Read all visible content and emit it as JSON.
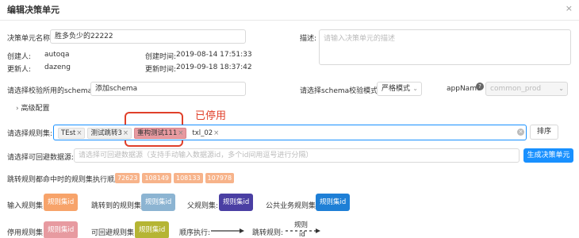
{
  "dialog": {
    "title": "编辑决策单元",
    "close_icon": "×"
  },
  "unit_name": {
    "label": "决策单元名称:",
    "value": "胜多负少的22222"
  },
  "description": {
    "label": "描述:",
    "placeholder": "请输入决策单元的描述"
  },
  "creator": {
    "label": "创建人:",
    "value": "autoqa"
  },
  "created_time": {
    "label": "创建时间:",
    "value": "2019-08-14 17:51:33"
  },
  "updater": {
    "label": "更新人:",
    "value": "dazeng"
  },
  "updated_time": {
    "label": "更新时间:",
    "value": "2019-09-18 18:37:42"
  },
  "schema": {
    "label": "请选择校验所用的schema:",
    "value": "添加schema"
  },
  "schema_mode": {
    "label": "请选择schema校验模式:",
    "value": "严格模式"
  },
  "app_name": {
    "label": "appName",
    "value": "common_prod"
  },
  "advanced": {
    "label": "高级配置"
  },
  "annotation": {
    "text": "已停用"
  },
  "rule_sets": {
    "label": "请选择规则集:",
    "tags": [
      {
        "text": "TEst"
      },
      {
        "text": "测试跳转3"
      },
      {
        "text": "重构测试111"
      },
      {
        "text": "txl_02"
      }
    ],
    "sort_button": "排序"
  },
  "avoid_data": {
    "label": "请选择可回避数据源:",
    "placeholder": "请选择可回避数据源（支持手动输入数据源id，多个id间用逗号进行分隔）",
    "generate_button": "生成决策单元"
  },
  "jump_order": {
    "label": "跳转规则都命中时的规则集执行顺序:",
    "ids": [
      "72623",
      "108149",
      "108133",
      "107978"
    ]
  },
  "legend": {
    "input_rule": {
      "label": "输入规则集:",
      "badge": "规则集id",
      "color": "#f7a36a"
    },
    "jump_to": {
      "label": "跳转到的规则集:",
      "badge": "规则集id",
      "color": "#8cb4d2"
    },
    "parent": {
      "label": "父规则集:",
      "badge": "规则集id",
      "color": "#4a3fa3"
    },
    "public": {
      "label": "公共业务规则集:",
      "badge": "规则集id",
      "color": "#1e7fd6"
    },
    "disabled": {
      "label": "停用规则集:",
      "badge": "规则集id",
      "color": "#e79aa0"
    },
    "avoid": {
      "label": "可回避规则集:",
      "badge": "规则集id",
      "color": "#b5b534"
    },
    "sequence": {
      "label": "顺序执行:"
    },
    "jump_rule": {
      "label": "跳转规则:",
      "text_top": "规则",
      "text_bottom": "id"
    }
  }
}
